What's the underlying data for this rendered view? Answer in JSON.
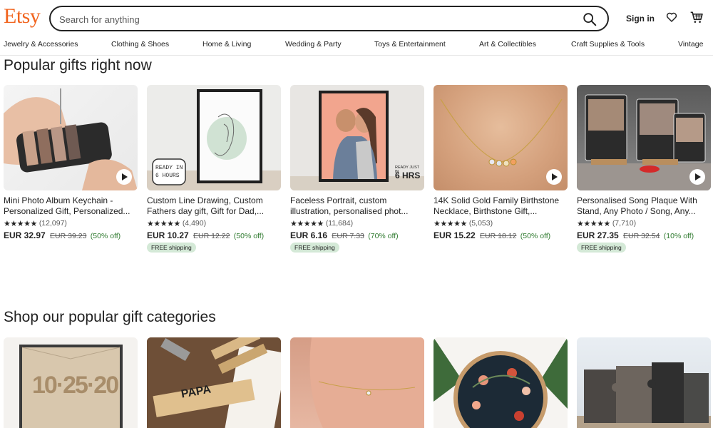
{
  "header": {
    "logo": "Etsy",
    "search_placeholder": "Search for anything",
    "signin": "Sign in"
  },
  "categories": [
    "Jewelry & Accessories",
    "Clothing & Shoes",
    "Home & Living",
    "Wedding & Party",
    "Toys & Entertainment",
    "Art & Collectibles",
    "Craft Supplies & Tools",
    "Vintage"
  ],
  "popular": {
    "title": "Popular gifts right now",
    "products": [
      {
        "title": "Mini Photo Album Keychain - Personalized Gift, Personalized...",
        "stars": "★★★★★",
        "reviews": "(12,097)",
        "price": "EUR 32.97",
        "old_price": "EUR 39.23",
        "discount": "(50% off)",
        "badge": "",
        "has_video": true
      },
      {
        "title": "Custom Line Drawing, Custom Fathers day gift, Gift for Dad,...",
        "stars": "★★★★★",
        "reviews": "(4,490)",
        "price": "EUR 10.27",
        "old_price": "EUR 12.22",
        "discount": "(50% off)",
        "badge": "FREE shipping",
        "image_text_1": "READY IN",
        "image_text_2": "6 HOURS",
        "has_video": false
      },
      {
        "title": "Faceless Portrait, custom illustration, personalised phot...",
        "stars": "★★★★★",
        "reviews": "(11,684)",
        "price": "EUR 6.16",
        "old_price": "EUR 7.33",
        "discount": "(70% off)",
        "badge": "FREE shipping",
        "image_text_1": "READY JUST IN",
        "image_text_2": "6 HRS",
        "has_video": false
      },
      {
        "title": "14K Solid Gold Family Birthstone Necklace, Birthstone Gift,...",
        "stars": "★★★★★",
        "reviews": "(5,053)",
        "price": "EUR 15.22",
        "old_price": "EUR 18.12",
        "discount": "(50% off)",
        "badge": "",
        "has_video": true
      },
      {
        "title": "Personalised Song Plaque With Stand, Any Photo / Song, Any...",
        "stars": "★★★★★",
        "reviews": "(7,710)",
        "price": "EUR 27.35",
        "old_price": "EUR 32.54",
        "discount": "(10% off)",
        "badge": "FREE shipping",
        "has_video": true
      }
    ]
  },
  "gift_categories": {
    "title": "Shop our popular gift categories",
    "tile_text": {
      "book_numbers": "10·25·20",
      "papa": "PAPA"
    }
  },
  "colors": {
    "brand": "#F1641E",
    "discount": "#2f7a2f",
    "badge_bg": "#d4e9d7"
  }
}
